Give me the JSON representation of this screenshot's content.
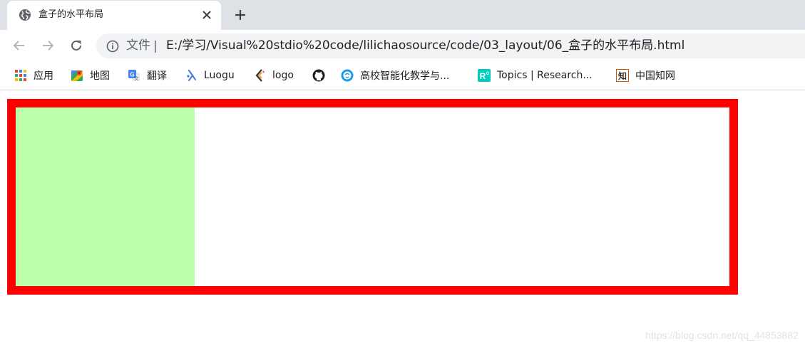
{
  "browser": {
    "tab": {
      "title": "盒子的水平布局"
    },
    "address_bar": {
      "scheme_label": "文件",
      "separator": "|",
      "url": "E:/学习/Visual%20stdio%20code/lilichaosource/code/03_layout/06_盒子的水平布局.html"
    },
    "bookmarks": [
      {
        "label": "应用",
        "icon": "apps-grid-icon"
      },
      {
        "label": "地图",
        "icon": "maps-icon"
      },
      {
        "label": "翻译",
        "icon": "translate-icon"
      },
      {
        "label": "Luogu",
        "icon": "luogu-icon"
      },
      {
        "label": "logo",
        "icon": "logo-icon"
      },
      {
        "label": "",
        "icon": "github-icon"
      },
      {
        "label": "高校智能化教学与...",
        "icon": "edu-icon"
      },
      {
        "label": "Topics | Research...",
        "icon": "researchgate-icon"
      },
      {
        "label": "中国知网",
        "icon": "cnki-icon"
      }
    ]
  },
  "page": {
    "outer_box": {
      "border_color": "#ff0000",
      "background": "#ffffff"
    },
    "inner_box": {
      "background": "#bbffaa"
    },
    "watermark": "https://blog.csdn.net/qq_44853882"
  },
  "colors": {
    "tabstrip": "#dee1e6",
    "omnibox": "#f1f3f4"
  }
}
